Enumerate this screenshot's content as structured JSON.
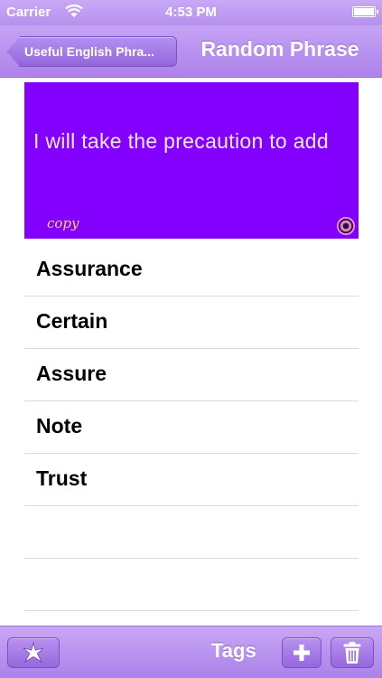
{
  "status_bar": {
    "carrier": "Carrier",
    "time": "4:53 PM"
  },
  "nav": {
    "back_label": "Useful English Phra...",
    "title": "Random Phrase"
  },
  "phrase_card": {
    "text": "I will take the precaution to add",
    "copy_label": "copy",
    "background_color": "#8300ff",
    "text_color": "#f3e9ff",
    "copy_color": "#f5d64c"
  },
  "tags": [
    {
      "label": "Assurance"
    },
    {
      "label": "Certain"
    },
    {
      "label": "Assure"
    },
    {
      "label": "Note"
    },
    {
      "label": "Trust"
    }
  ],
  "toolbar": {
    "tags_label": "Tags",
    "icons": [
      "star-icon",
      "plus-icon",
      "trash-icon"
    ]
  },
  "theme": {
    "accent": "#b791ee"
  }
}
